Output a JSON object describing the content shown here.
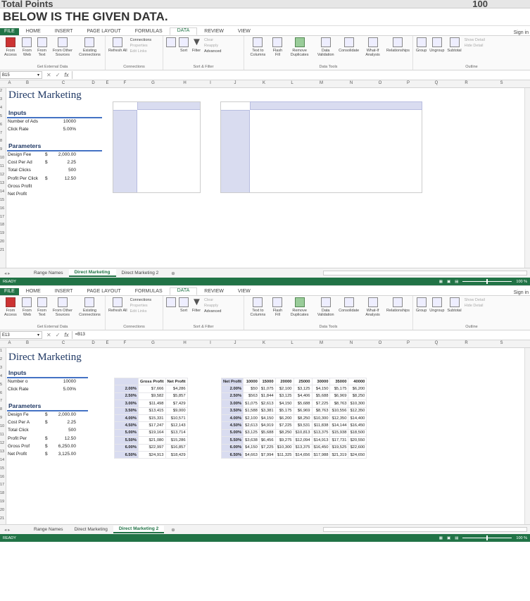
{
  "top": {
    "partial_left": "Total Points",
    "partial_right": "100",
    "heading": "BELOW IS THE GIVEN DATA."
  },
  "ribbon": {
    "tabs": [
      "FILE",
      "HOME",
      "INSERT",
      "PAGE LAYOUT",
      "FORMULAS",
      "DATA",
      "REVIEW",
      "VIEW"
    ],
    "sign_in": "Sign in",
    "groups": {
      "external": "Get External Data",
      "connections": "Connections",
      "sort": "Sort & Filter",
      "tools": "Data Tools",
      "outline": "Outline"
    },
    "external_buttons": [
      "From Access",
      "From Web",
      "From Text",
      "From Other Sources",
      "Existing Connections"
    ],
    "connections_buttons": {
      "refresh": "Refresh All",
      "connections": "Connections",
      "properties": "Properties",
      "edit_links": "Edit Links"
    },
    "sort_buttons": {
      "sort": "Sort",
      "filter": "Filter",
      "clear": "Clear",
      "reapply": "Reapply",
      "advanced": "Advanced"
    },
    "tool_buttons": [
      "Text to Columns",
      "Flash Fill",
      "Remove Duplicates",
      "Data Validation",
      "Consolidate",
      "What-If Analysis",
      "Relationships"
    ],
    "outline_buttons": {
      "group": "Group",
      "ungroup": "Ungroup",
      "subtotal": "Subtotal",
      "show_detail": "Show Detail",
      "hide_detail": "Hide Detail"
    }
  },
  "columns": [
    "A",
    "B",
    "C",
    "D",
    "E",
    "F",
    "G",
    "H",
    "I",
    "J",
    "K",
    "L",
    "M",
    "N",
    "O",
    "P",
    "Q",
    "R",
    "S"
  ],
  "window1": {
    "name_box": "B15",
    "formula": "",
    "title": "Direct Marketing",
    "inputs_label": "Inputs",
    "inputs": [
      {
        "label": "Number of Ads",
        "value": "10000"
      },
      {
        "label": "Click Rate",
        "value": "5.00%"
      }
    ],
    "params_label": "Parameters",
    "params": [
      {
        "label": "Design Fee",
        "cur": "$",
        "value": "2,000.00"
      },
      {
        "label": "Cost Per Ad",
        "cur": "$",
        "value": "2.25"
      },
      {
        "label": "Total Clicks",
        "cur": "",
        "value": "500"
      },
      {
        "label": "Profit Per Click",
        "cur": "$",
        "value": "12.50"
      },
      {
        "label": "Gross Profit",
        "cur": "",
        "value": ""
      },
      {
        "label": "Net Profit",
        "cur": "",
        "value": ""
      }
    ],
    "rows": [
      "2",
      "3",
      "4",
      "5",
      "6",
      "7",
      "8",
      "9",
      "10",
      "11",
      "12",
      "13",
      "14",
      "15",
      "16",
      "17",
      "18",
      "19",
      "20",
      "21"
    ],
    "sheets": [
      "Range Names",
      "Direct Marketing",
      "Direct Marketing 2"
    ],
    "active_sheet": "Direct Marketing",
    "status": "READY",
    "zoom": "100 %"
  },
  "window2": {
    "name_box": "E13",
    "formula": "=B13",
    "title": "Direct Marketing",
    "inputs_label": "Inputs",
    "inputs": [
      {
        "label": "Number o",
        "value": "10000"
      },
      {
        "label": "Click Rate",
        "value": "5.00%"
      }
    ],
    "params_label": "Parameters",
    "params": [
      {
        "label": "Design Fe",
        "cur": "$",
        "value": "2,000.00"
      },
      {
        "label": "Cost Per A",
        "cur": "$",
        "value": "2.25"
      },
      {
        "label": "Total Click",
        "cur": "",
        "value": "500"
      },
      {
        "label": "Profit Per",
        "cur": "$",
        "value": "12.50"
      },
      {
        "label": "Gross Prof",
        "cur": "$",
        "value": "6,250.00"
      },
      {
        "label": "Net Profit",
        "cur": "$",
        "value": "3,125.00"
      }
    ],
    "rows": [
      "1",
      "2",
      "3",
      "4",
      "5",
      "6",
      "7",
      "8",
      "9",
      "10",
      "11",
      "12",
      "13",
      "14",
      "15",
      "16",
      "17",
      "18",
      "19",
      "20",
      "21"
    ],
    "table1": {
      "headers": [
        "Gross Profit",
        "Net Profit"
      ],
      "rates": [
        "2.00%",
        "2.50%",
        "3.00%",
        "3.50%",
        "4.00%",
        "4.50%",
        "5.00%",
        "5.50%",
        "6.00%",
        "6.50%"
      ],
      "gross": [
        "$7,666",
        "$9,582",
        "$11,498",
        "$13,415",
        "$15,331",
        "$17,247",
        "$19,164",
        "$21,080",
        "$22,997",
        "$24,913"
      ],
      "net": [
        "$4,286",
        "$5,857",
        "$7,429",
        "$9,000",
        "$10,571",
        "$12,143",
        "$13,714",
        "$15,286",
        "$16,857",
        "$18,429"
      ]
    },
    "table2": {
      "corner": "Net Profit",
      "headers": [
        "10000",
        "15000",
        "20000",
        "25000",
        "30000",
        "35000",
        "40000"
      ],
      "rates": [
        "2.00%",
        "2.50%",
        "3.00%",
        "3.50%",
        "4.00%",
        "4.50%",
        "5.00%",
        "5.50%",
        "6.00%",
        "6.50%"
      ],
      "rows": [
        [
          "$50",
          "$1,075",
          "$2,100",
          "$3,125",
          "$4,150",
          "$5,175",
          "$6,200"
        ],
        [
          "$563",
          "$1,844",
          "$3,125",
          "$4,406",
          "$5,688",
          "$6,969",
          "$8,250"
        ],
        [
          "$1,075",
          "$2,613",
          "$4,150",
          "$5,688",
          "$7,225",
          "$8,763",
          "$10,300"
        ],
        [
          "$1,588",
          "$3,381",
          "$5,175",
          "$6,969",
          "$8,763",
          "$10,556",
          "$12,350"
        ],
        [
          "$2,100",
          "$4,150",
          "$6,200",
          "$8,250",
          "$10,300",
          "$12,350",
          "$14,400"
        ],
        [
          "$2,613",
          "$4,919",
          "$7,225",
          "$9,531",
          "$11,838",
          "$14,144",
          "$16,450"
        ],
        [
          "$3,125",
          "$5,688",
          "$8,250",
          "$10,813",
          "$13,375",
          "$15,938",
          "$18,500"
        ],
        [
          "$3,638",
          "$6,456",
          "$9,275",
          "$12,094",
          "$14,913",
          "$17,731",
          "$20,550"
        ],
        [
          "$4,150",
          "$7,225",
          "$10,300",
          "$13,375",
          "$16,450",
          "$19,525",
          "$22,600"
        ],
        [
          "$4,663",
          "$7,994",
          "$11,325",
          "$14,656",
          "$17,988",
          "$21,319",
          "$24,650"
        ]
      ]
    },
    "sheets": [
      "Range Names",
      "Direct Marketing",
      "Direct Marketing 2"
    ],
    "active_sheet": "Direct Marketing 2",
    "status": "READY",
    "zoom": "100 %"
  }
}
